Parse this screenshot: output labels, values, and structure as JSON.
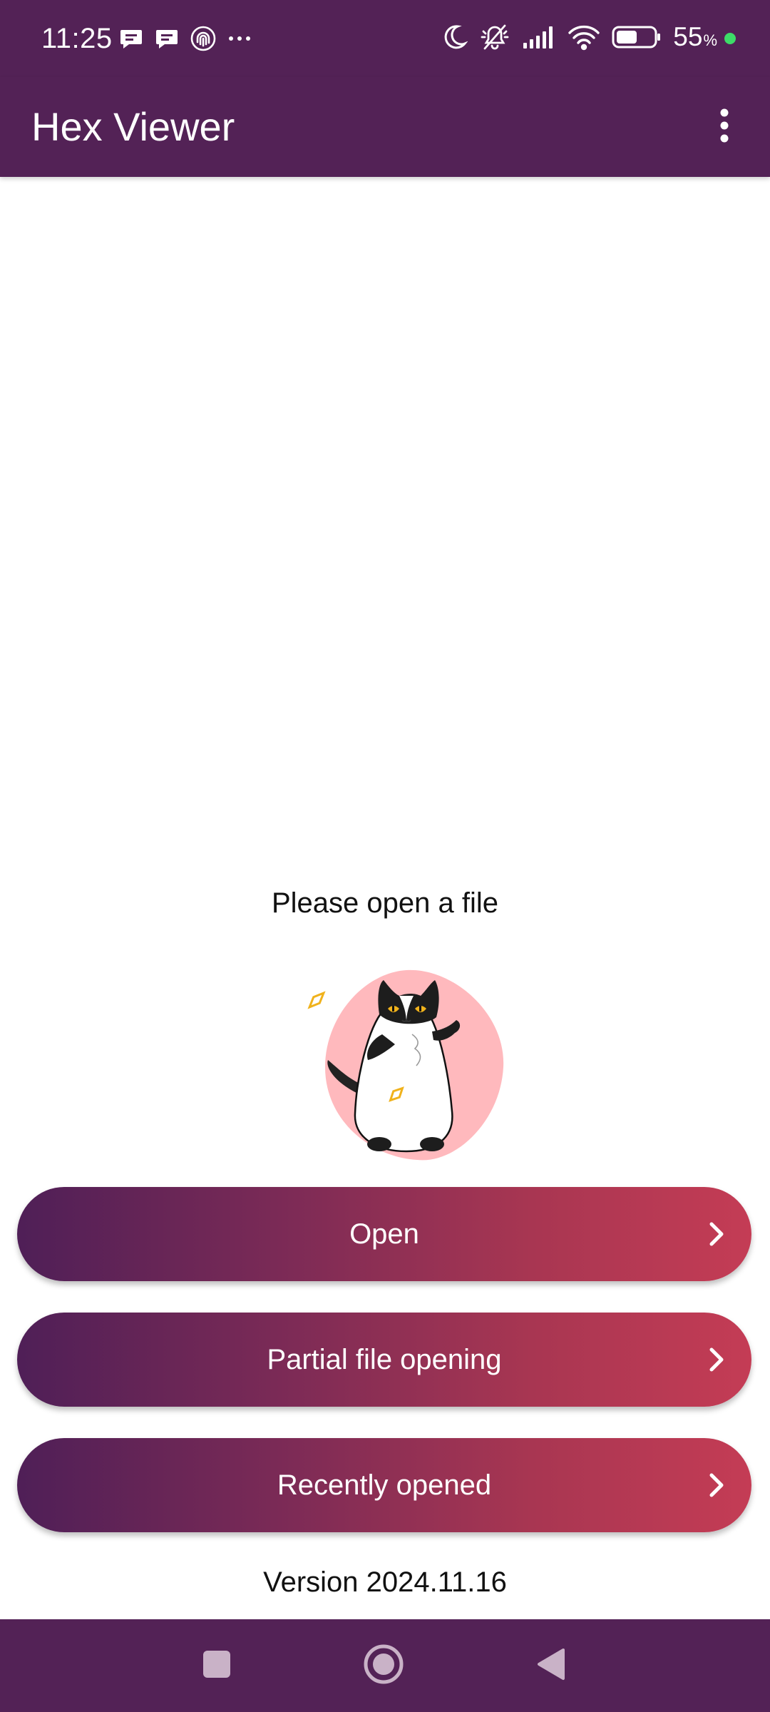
{
  "status_bar": {
    "time": "11:25",
    "battery_percent": "55",
    "battery_unit": "%",
    "left_icons": [
      "message-icon",
      "message-icon",
      "fingerprint-icon",
      "more-dots-icon"
    ],
    "right_icons": [
      "moon-icon",
      "vibrate-off-icon",
      "signal-icon",
      "wifi-icon",
      "battery-icon"
    ],
    "charge_dot_color": "#3ddc68"
  },
  "app_bar": {
    "title": "Hex Viewer",
    "menu_icon": "more-vert-icon"
  },
  "content": {
    "empty_message": "Please open a file",
    "illustration": "cat-illustration"
  },
  "actions": {
    "open_label": "Open",
    "partial_label": "Partial file opening",
    "recent_label": "Recently opened",
    "chevron_icon": "chevron-right-icon"
  },
  "footer": {
    "version": "Version 2024.11.16"
  },
  "nav_bar": {
    "items": [
      "recents-icon",
      "home-icon",
      "back-icon"
    ]
  },
  "colors": {
    "primary": "#532256",
    "gradient_start": "#4f1f57",
    "gradient_end": "#c43c55",
    "illustration_bg": "#ffb9bd",
    "cat_eyes": "#f0b21c"
  }
}
